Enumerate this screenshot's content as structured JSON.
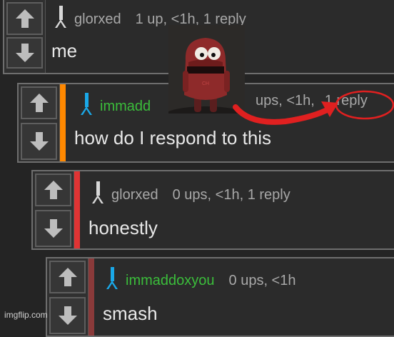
{
  "comments": [
    {
      "user": "glorxed",
      "meta": "1 up, <1h, 1 reply",
      "text": "me"
    },
    {
      "user": "immaddoxyou",
      "user_visible": "immadd",
      "meta": "ups, <1h,",
      "meta_tail": "1 reply",
      "text": "how do I respond to this"
    },
    {
      "user": "glorxed",
      "meta": "0 ups, <1h, 1 reply",
      "text": "honestly"
    },
    {
      "user": "immaddoxyou",
      "meta": "0 ups, <1h",
      "text": "smash"
    }
  ],
  "watermark": "imgflip.com",
  "icons": {
    "upvote": "arrow-up-icon",
    "downvote": "arrow-down-icon",
    "avatar_gray": "stick-figure-avatar-icon",
    "avatar_blue": "stick-figure-avatar-icon"
  },
  "colors": {
    "rail_orange": "#ff8800",
    "rail_red": "#e03434",
    "rail_maroon": "#8a3a3a",
    "avatar_blue": "#1aa8e8",
    "username_green": "#3bbd3b",
    "annotation_red": "#e02020"
  }
}
